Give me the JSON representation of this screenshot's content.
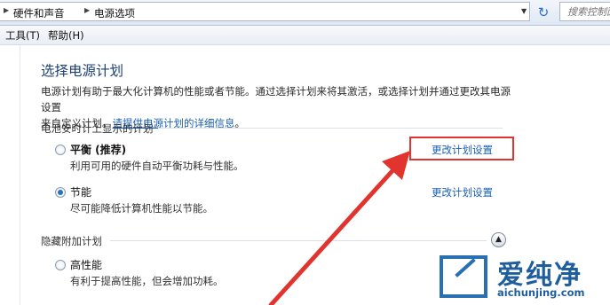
{
  "address_bar": {
    "crumbs": [
      "硬件和声音",
      "电源选项"
    ],
    "search_placeholder": "搜索控制面板"
  },
  "menu": {
    "items": [
      "工具(T)",
      "帮助(H)"
    ]
  },
  "main": {
    "title": "选择电源计划",
    "description_line1": "电源计划有助于最大化计算机的性能或者节能。通过选择计划来将其激活，或选择计划并通过更改其电源设置",
    "description_line2_prefix": "来自定义计划。",
    "description_link": "请提供电源计划的详细信息",
    "description_line2_suffix": "。"
  },
  "battery_section": {
    "label": "电池安时计上显示的计划",
    "plans": [
      {
        "name": "平衡 (推荐)",
        "description": "利用可用的硬件自动平衡功耗与性能。",
        "link": "更改计划设置",
        "selected": false
      },
      {
        "name": "节能",
        "description": "尽可能降低计算机性能以节能。",
        "link": "更改计划设置",
        "selected": true
      }
    ]
  },
  "hidden_section": {
    "label": "隐藏附加计划",
    "plans": [
      {
        "name": "高性能",
        "description": "有利于提高性能，但会增加功耗。",
        "selected": false
      }
    ]
  },
  "watermark": {
    "title": "爱纯净",
    "url": "aichunjing.com"
  },
  "colors": {
    "accent": "#1a5fb4",
    "title": "#1d3f73",
    "annotation": "#e2342f"
  }
}
